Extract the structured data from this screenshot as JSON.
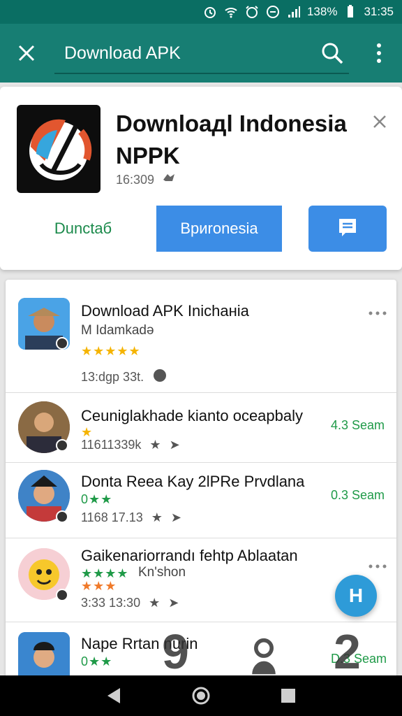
{
  "status_bar": {
    "battery": "138%",
    "time": "31:35",
    "icons": [
      "alarm-icon",
      "wifi-icon",
      "alarm-clock-icon",
      "do-not-disturb-icon",
      "signal-icon",
      "battery-icon"
    ]
  },
  "app_bar": {
    "search_text": "Download APK",
    "icons": [
      "close-icon",
      "search-icon",
      "more-vert-icon"
    ],
    "color": "#177e73"
  },
  "hero": {
    "title": "Downloaдl Indonesia NPPK",
    "meta": "16:309",
    "btn_download": "Dunctaб",
    "btn_primary": "Вpиronesia",
    "icons": [
      "app-logo-icon",
      "dismiss-icon",
      "verified-icon",
      "feedback-icon"
    ]
  },
  "list": {
    "items": [
      {
        "name": "Download APK Inichaнia",
        "sub": "M Idamkadǝ",
        "stars": "★★★★★",
        "meta": "13:dgp 33t.",
        "right": ""
      },
      {
        "name": "Ceuniglakhade kianto oceapbaly",
        "stars": "★",
        "meta": "11611339k",
        "right": "4.3 Seam"
      },
      {
        "name": "Donta Reea Kay 2lPRe Prvdlana",
        "stars": "0★★",
        "meta": "1168 17.13",
        "right": "0.3 Seam"
      },
      {
        "name": "Gaikenariorrandı fehtp Ablaatan",
        "sub": "Kn'shon",
        "stars": "★★★★",
        "stars2": "★★★",
        "meta": "3:33 13:30",
        "right": ""
      },
      {
        "name": "Nape Rrtan nurin",
        "stars": "0★★",
        "meta": "",
        "right": "D.3 Seam"
      }
    ]
  },
  "fab": {
    "label": "H"
  },
  "overlay": {
    "g1": "9",
    "g3": "2"
  },
  "nav_bar": {
    "icons": [
      "back-icon",
      "home-icon",
      "recents-icon"
    ]
  }
}
